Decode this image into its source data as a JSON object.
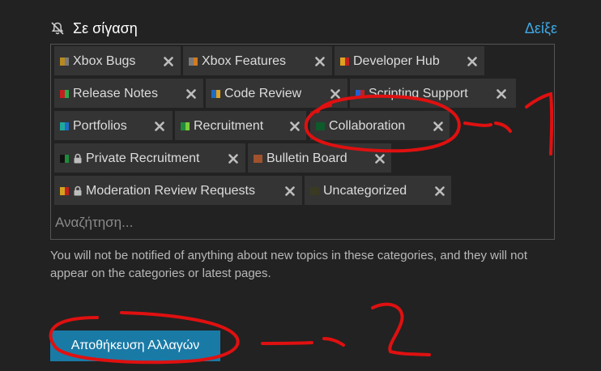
{
  "header": {
    "title": "Σε σίγαση",
    "show_link": "Δείξε"
  },
  "categories": [
    {
      "label": "Xbox Bugs",
      "colors": [
        "#b8891f",
        "#7a7a7a"
      ],
      "locked": false
    },
    {
      "label": "Xbox Features",
      "colors": [
        "#7a7a7a",
        "#d47a1f"
      ],
      "locked": false
    },
    {
      "label": "Developer Hub",
      "colors": [
        "#e0a21f",
        "#c41f1f"
      ],
      "locked": false
    },
    {
      "label": "Release Notes",
      "colors": [
        "#c41f1f",
        "#2ea84a"
      ],
      "locked": false
    },
    {
      "label": "Code Review",
      "colors": [
        "#1f6bc4",
        "#e0a21f"
      ],
      "locked": false
    },
    {
      "label": "Scripting Support",
      "colors": [
        "#1f5fd4",
        "#c41f1f"
      ],
      "locked": false
    },
    {
      "label": "Portfolios",
      "colors": [
        "#1fa89a",
        "#1f6bc4"
      ],
      "locked": false
    },
    {
      "label": "Recruitment",
      "colors": [
        "#1f8a3a",
        "#7acc3a"
      ],
      "locked": false
    },
    {
      "label": "Collaboration",
      "colors": [
        "#0f5a2a",
        "#0f5a2a"
      ],
      "locked": false
    },
    {
      "label": "Private Recruitment",
      "colors": [
        "#111111",
        "#1f8a3a"
      ],
      "locked": true
    },
    {
      "label": "Bulletin Board",
      "colors": [
        "#a0522d",
        "#a0522d"
      ],
      "locked": false
    },
    {
      "label": "Moderation Review Requests",
      "colors": [
        "#d4a21f",
        "#c41f1f"
      ],
      "locked": true
    },
    {
      "label": "Uncategorized",
      "colors": [
        "#3a3a22",
        "#3a3a22"
      ],
      "locked": false
    }
  ],
  "search": {
    "placeholder": "Αναζήτηση...",
    "value": ""
  },
  "help_text": "You will not be notified of anything about new topics in these categories, and they will not appear on the categories or latest pages.",
  "save_button": "Αποθήκευση Αλλαγών",
  "colors": {
    "background": "#222222",
    "chip": "#343434",
    "link": "#3fa9e5",
    "primary_button": "#1a7aa6",
    "annotation": "#e01010"
  }
}
